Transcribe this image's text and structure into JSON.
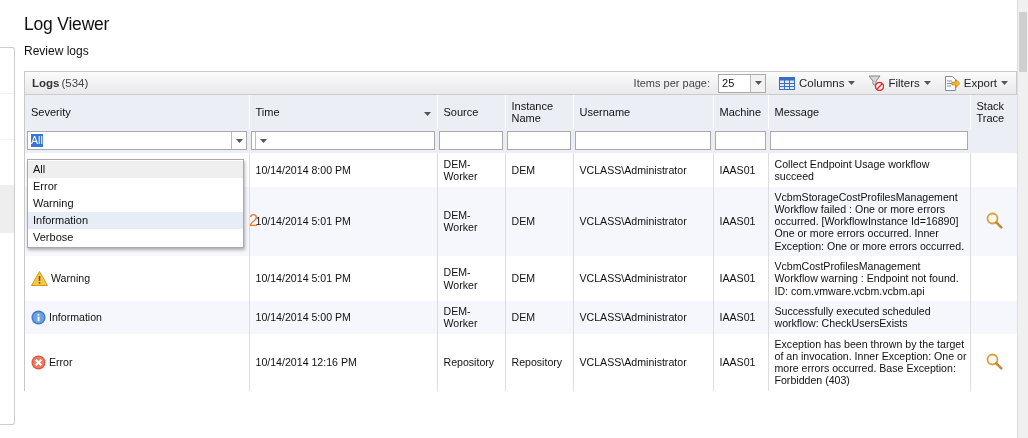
{
  "page": {
    "title": "Log Viewer",
    "subtitle": "Review logs"
  },
  "panel": {
    "title": "Logs",
    "count": "(534)",
    "items_per_page_label": "Items per page:",
    "items_per_page": "25",
    "tools": [
      {
        "kind": "columns",
        "label": "Columns"
      },
      {
        "kind": "filters",
        "label": "Filters"
      },
      {
        "kind": "export",
        "label": "Export"
      }
    ]
  },
  "columns": [
    {
      "label": "Severity",
      "sorted": false
    },
    {
      "label": "Time",
      "sorted": true
    },
    {
      "label": "Source",
      "sorted": false
    },
    {
      "label": "Instance Name",
      "sorted": false
    },
    {
      "label": "Username",
      "sorted": false
    },
    {
      "label": "Machine",
      "sorted": false
    },
    {
      "label": "Message",
      "sorted": false
    },
    {
      "label": "Stack Trace",
      "sorted": false
    }
  ],
  "filters": [
    {
      "kind": "combo",
      "value": "All",
      "value_selected": true
    },
    {
      "kind": "combo"
    },
    {
      "kind": "text"
    },
    {
      "kind": "text"
    },
    {
      "kind": "text"
    },
    {
      "kind": "text"
    },
    {
      "kind": "text"
    },
    {
      "kind": "none"
    }
  ],
  "severity_menu": {
    "options": [
      {
        "label": "All",
        "selected": true,
        "hovered": false
      },
      {
        "label": "Error",
        "selected": false,
        "hovered": false
      },
      {
        "label": "Warning",
        "selected": false,
        "hovered": false
      },
      {
        "label": "Information",
        "selected": false,
        "hovered": true,
        "callout": "2"
      },
      {
        "label": "Verbose",
        "selected": false,
        "hovered": false
      }
    ]
  },
  "rows": [
    {
      "time": "10/14/2014 8:00 PM",
      "source": "DEM-Worker",
      "instance": "DEM",
      "username": "VCLASS\\Administrator",
      "machine": "IAAS01",
      "message": "Collect Endpoint Usage workflow succeed",
      "stack_trace": false
    },
    {
      "time": "10/14/2014 5:01 PM",
      "source": "DEM-Worker",
      "instance": "DEM",
      "username": "VCLASS\\Administrator",
      "machine": "IAAS01",
      "message": "VcbmStorageCostProfilesManagement Workflow failed : One or more errors occurred. [WorkflowInstance Id=16890] One or more errors occurred. Inner Exception:  One or more errors occurred.",
      "stack_trace": true
    },
    {
      "severity": {
        "kind": "warning",
        "label": "Warning"
      },
      "time": "10/14/2014 5:01 PM",
      "source": "DEM-Worker",
      "instance": "DEM",
      "username": "VCLASS\\Administrator",
      "machine": "IAAS01",
      "message": "VcbmCostProfilesManagement Workflow warning : Endpoint not found. ID: com.vmware.vcbm.vcbm.api",
      "stack_trace": false
    },
    {
      "severity": {
        "kind": "information",
        "label": "Information"
      },
      "time": "10/14/2014 5:00 PM",
      "source": "DEM-Worker",
      "instance": "DEM",
      "username": "VCLASS\\Administrator",
      "machine": "IAAS01",
      "message": "Successfully executed scheduled workflow: CheckUsersExists",
      "stack_trace": false
    },
    {
      "severity": {
        "kind": "error",
        "label": "Error"
      },
      "time": "10/14/2014 12:16 PM",
      "source": "Repository",
      "instance": "Repository",
      "username": "VCLASS\\Administrator",
      "machine": "IAAS01",
      "message": "Exception has been thrown by the target of an invocation. Inner Exception:  One or more errors occurred. Base Exception:  Forbidden (403)",
      "stack_trace": true
    }
  ]
}
